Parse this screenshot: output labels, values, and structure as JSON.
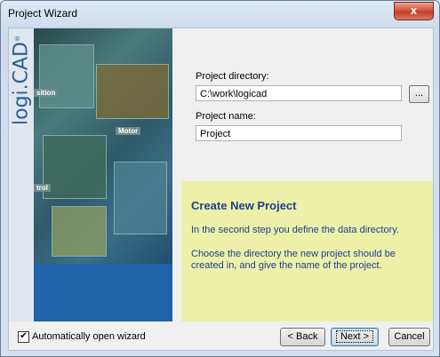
{
  "window": {
    "title": "Project Wizard",
    "close_glyph": "x"
  },
  "banner": {
    "logo": "logi.CAD",
    "tags": [
      "sition",
      "Motor",
      "trol"
    ]
  },
  "form": {
    "project_directory_label": "Project directory:",
    "project_directory_value": "C:\\work\\logicad",
    "browse_label": "...",
    "project_name_label": "Project name:",
    "project_name_value": "Project"
  },
  "info": {
    "title": "Create New Project",
    "line1": "In the second step you define the data directory.",
    "line2": "Choose the directory the new project should be created in, and give the name of the project."
  },
  "footer": {
    "auto_open_checked": true,
    "auto_open_label": "Automatically open wizard",
    "back_label": "< Back",
    "next_label": "Next >",
    "cancel_label": "Cancel"
  },
  "colors": {
    "info_bg": "#ecf0a8",
    "info_text": "#1c3f8f",
    "banner_blue": "#1b5c9e"
  }
}
